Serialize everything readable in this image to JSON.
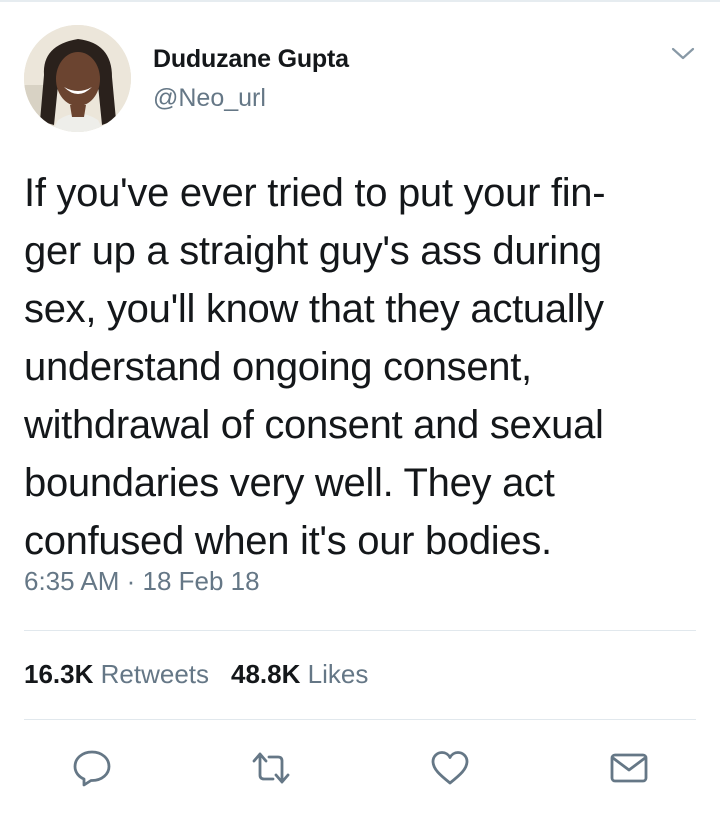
{
  "tweet": {
    "author": {
      "display_name": "Duduzane Gupta",
      "handle": "@Neo_url",
      "avatar_icon": "avatar-photo"
    },
    "text_lines": [
      "If you've ever tried to put your fin-",
      "ger up a straight guy's ass during",
      "sex, you'll know that they actually",
      "understand ongoing consent,",
      "withdrawal of consent and sexual",
      "boundaries very well. They act",
      "confused when it's our bodies."
    ],
    "timestamp": "6:35 AM · 18 Feb 18",
    "stats": {
      "retweets_count": "16.3K",
      "retweets_label": "Retweets",
      "likes_count": "48.8K",
      "likes_label": "Likes"
    },
    "actions": [
      {
        "name": "reply",
        "icon": "reply-icon"
      },
      {
        "name": "retweet",
        "icon": "retweet-icon"
      },
      {
        "name": "like",
        "icon": "heart-icon"
      },
      {
        "name": "share",
        "icon": "mail-icon"
      }
    ]
  },
  "colors": {
    "text_primary": "#14171a",
    "text_secondary": "#657786",
    "divider": "#e1e8ed",
    "icon": "#657786"
  }
}
